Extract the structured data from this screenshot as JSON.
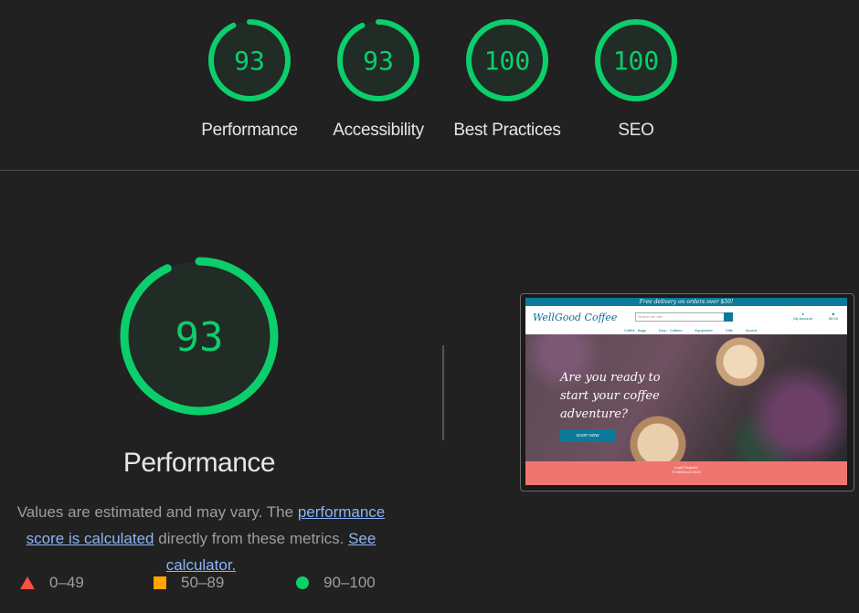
{
  "summary": {
    "categories": [
      {
        "label": "Performance",
        "score": 93
      },
      {
        "label": "Accessibility",
        "score": 93
      },
      {
        "label": "Best Practices",
        "score": 100
      },
      {
        "label": "SEO",
        "score": 100
      }
    ]
  },
  "detail": {
    "score": 93,
    "title": "Performance",
    "note_prefix": "Values are estimated and may vary. The ",
    "note_link1": "performance score is calculated",
    "note_middle": " directly from these metrics. ",
    "note_link2": "See calculator."
  },
  "legend": {
    "fail": "0–49",
    "average": "50–89",
    "pass": "90–100"
  },
  "colors": {
    "pass": "#0cce6b",
    "average": "#ffa400",
    "fail": "#ff4e42",
    "link": "#8ab4f8",
    "background": "#212121"
  },
  "thumbnail": {
    "banner": "Free delivery on orders over $50!",
    "logo": "WellGood Coffee",
    "search_placeholder": "Search our site",
    "account": "My Account",
    "bag": "$0.00",
    "nav": [
      "Coffee Bags",
      "Drop Coffees",
      "Equipment",
      "Gifts",
      "Accent"
    ],
    "hero_heading": "Are you ready to start your coffee adventure?",
    "shop_button": "SHOP NOW",
    "footer_line1": "Login Register",
    "footer_line2": "© WellGood 2023"
  }
}
